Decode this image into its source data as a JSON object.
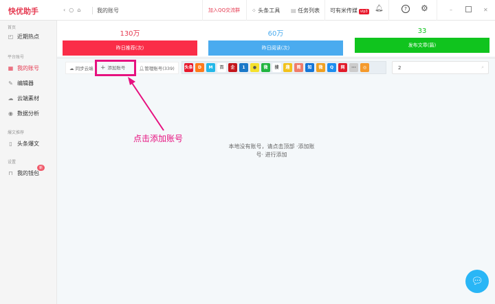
{
  "app": {
    "title": "快优助手"
  },
  "header": {
    "breadcrumb": "我的账号",
    "qq_group": "加入QQ交流群",
    "toutiao_tools": "头条工具",
    "task_list": "任务列表",
    "user": "可有米传媒",
    "vip": "vip3"
  },
  "sidebar": {
    "sections": [
      {
        "label": "首页"
      },
      {
        "label": "平台账号"
      },
      {
        "label": "爆文推荐"
      },
      {
        "label": "设置"
      }
    ],
    "items": [
      {
        "label": "近期热点",
        "icon": "hot-icon"
      },
      {
        "label": "我的账号",
        "icon": "grid-icon"
      },
      {
        "label": "编辑器",
        "icon": "edit-icon"
      },
      {
        "label": "云端素材",
        "icon": "cloud-icon"
      },
      {
        "label": "数据分析",
        "icon": "eye-icon"
      },
      {
        "label": "头条爆文",
        "icon": "document-icon"
      },
      {
        "label": "我的钱包",
        "icon": "wallet-icon",
        "badge": "新"
      }
    ]
  },
  "stats": [
    {
      "value": "130万",
      "label": "昨日推荐(次)",
      "color": "#fa2d48"
    },
    {
      "value": "60万",
      "label": "昨日阅读(次)",
      "color": "#4aabef"
    },
    {
      "value": "33",
      "label": "发布文章(篇)",
      "color": "#10c41e"
    }
  ],
  "toolbar": {
    "sync": "同步云端",
    "add": "添加账号",
    "manage": "管理账号(339)",
    "search_value": "2"
  },
  "platforms": [
    {
      "t": "头条",
      "c": "#e8192c"
    },
    {
      "t": "D",
      "c": "#ff7a1a"
    },
    {
      "t": "M",
      "c": "#23b8e8"
    },
    {
      "t": "百",
      "c": "#ffffff"
    },
    {
      "t": "企",
      "c": "#c4161c"
    },
    {
      "t": "1",
      "c": "#1a78c8"
    },
    {
      "t": "●",
      "c": "#f5e12d"
    },
    {
      "t": "微",
      "c": "#21b540"
    },
    {
      "t": "搜",
      "c": "#ffffff"
    },
    {
      "t": "趣",
      "c": "#f2c21b"
    },
    {
      "t": "简",
      "c": "#f07c6a"
    },
    {
      "t": "知",
      "c": "#1476d8"
    },
    {
      "t": "微",
      "c": "#f0a020"
    },
    {
      "t": "Q",
      "c": "#1d8ef0"
    },
    {
      "t": "网",
      "c": "#e21b2a"
    },
    {
      "t": "···",
      "c": "#cccccc"
    },
    {
      "t": "◎",
      "c": "#f59a2c"
    }
  ],
  "annotation": "点击添加账号",
  "empty_message": "本地没有账号，请点击顶部 ·添加账号· 进行添加"
}
